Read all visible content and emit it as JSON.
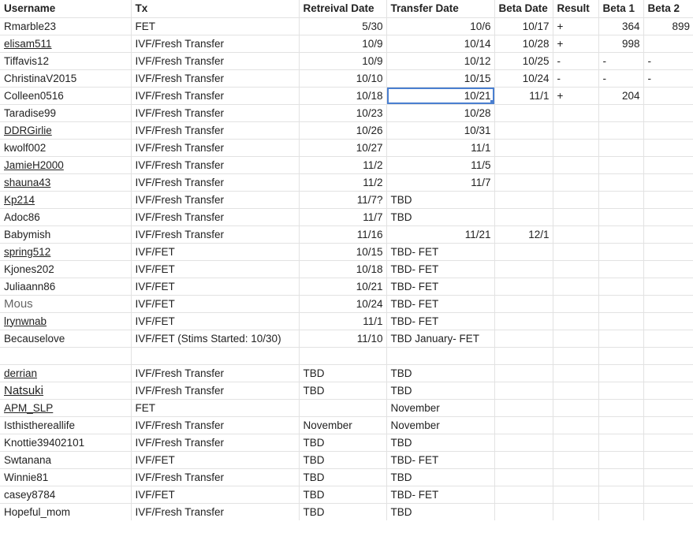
{
  "headers": {
    "username": "Username",
    "tx": "Tx",
    "retrieval": "Retreival Date",
    "transfer": "Transfer Date",
    "beta_date": "Beta Date",
    "result": "Result",
    "beta1": "Beta 1",
    "beta2": "Beta 2"
  },
  "rows": [
    {
      "user": "Rmarble23",
      "tx": "FET",
      "ret": "5/30",
      "tr": "10/6",
      "beta": "10/17",
      "res": "+",
      "b1": "364",
      "b2": "899"
    },
    {
      "user": "elisam511",
      "tx": "IVF/Fresh Transfer",
      "ret": "10/9",
      "tr": "10/14",
      "beta": "10/28",
      "res": "+",
      "b1": "998",
      "b2": ""
    },
    {
      "user": "Tiffavis12",
      "tx": "IVF/Fresh Transfer",
      "ret": "10/9",
      "tr": "10/12",
      "beta": "10/25",
      "res": "-",
      "b1": "-",
      "b2": "-"
    },
    {
      "user": "ChristinaV2015",
      "tx": "IVF/Fresh Transfer",
      "ret": "10/10",
      "tr": "10/15",
      "beta": "10/24",
      "res": "-",
      "b1": "-",
      "b2": "-"
    },
    {
      "user": "Colleen0516",
      "tx": "IVF/Fresh Transfer",
      "ret": "10/18",
      "tr": "10/21",
      "beta": "11/1",
      "res": "+",
      "b1": "204",
      "b2": ""
    },
    {
      "user": "Taradise99",
      "tx": "IVF/Fresh Transfer",
      "ret": "10/23",
      "tr": "10/28",
      "beta": "",
      "res": "",
      "b1": "",
      "b2": ""
    },
    {
      "user": "DDRGirlie",
      "tx": "IVF/Fresh Transfer",
      "ret": "10/26",
      "tr": "10/31",
      "beta": "",
      "res": "",
      "b1": "",
      "b2": ""
    },
    {
      "user": "kwolf002",
      "tx": "IVF/Fresh Transfer",
      "ret": "10/27",
      "tr": "11/1",
      "beta": "",
      "res": "",
      "b1": "",
      "b2": ""
    },
    {
      "user": "JamieH2000",
      "tx": "IVF/Fresh Transfer",
      "ret": "11/2",
      "tr": "11/5",
      "beta": "",
      "res": "",
      "b1": "",
      "b2": ""
    },
    {
      "user": "shauna43",
      "tx": "IVF/Fresh Transfer",
      "ret": "11/2",
      "tr": "11/7",
      "beta": "",
      "res": "",
      "b1": "",
      "b2": ""
    },
    {
      "user": "Kp214",
      "tx": "IVF/Fresh Transfer",
      "ret": "11/7?",
      "tr": "TBD",
      "beta": "",
      "res": "",
      "b1": "",
      "b2": ""
    },
    {
      "user": "Adoc86",
      "tx": "IVF/Fresh Transfer",
      "ret": "11/7",
      "tr": "TBD",
      "beta": "",
      "res": "",
      "b1": "",
      "b2": ""
    },
    {
      "user": "Babymish",
      "tx": "IVF/Fresh Transfer",
      "ret": "11/16",
      "tr": "11/21",
      "beta": "12/1",
      "res": "",
      "b1": "",
      "b2": ""
    },
    {
      "user": "spring512",
      "tx": "IVF/FET",
      "ret": "10/15",
      "tr": "TBD- FET",
      "beta": "",
      "res": "",
      "b1": "",
      "b2": ""
    },
    {
      "user": "Kjones202",
      "tx": "IVF/FET",
      "ret": "10/18",
      "tr": "TBD- FET",
      "beta": "",
      "res": "",
      "b1": "",
      "b2": ""
    },
    {
      "user": "Juliaann86",
      "tx": "IVF/FET",
      "ret": "10/21",
      "tr": "TBD- FET",
      "beta": "",
      "res": "",
      "b1": "",
      "b2": ""
    },
    {
      "user": "Mous",
      "tx": "IVF/FET",
      "ret": "10/24",
      "tr": "TBD- FET",
      "beta": "",
      "res": "",
      "b1": "",
      "b2": ""
    },
    {
      "user": "lrynwnab",
      "tx": "IVF/FET",
      "ret": "11/1",
      "tr": "TBD- FET",
      "beta": "",
      "res": "",
      "b1": "",
      "b2": ""
    },
    {
      "user": "Becauselove",
      "tx": "IVF/FET (Stims Started: 10/30)",
      "ret": "11/10",
      "tr": "TBD January- FET",
      "beta": "",
      "res": "",
      "b1": "",
      "b2": ""
    },
    {
      "user": "",
      "tx": "",
      "ret": "",
      "tr": "",
      "beta": "",
      "res": "",
      "b1": "",
      "b2": ""
    },
    {
      "user": "derrian",
      "tx": "IVF/Fresh Transfer",
      "ret": "TBD",
      "tr": "TBD",
      "beta": "",
      "res": "",
      "b1": "",
      "b2": ""
    },
    {
      "user": "Natsuki",
      "tx": "IVF/Fresh Transfer",
      "ret": "TBD",
      "tr": "TBD",
      "beta": "",
      "res": "",
      "b1": "",
      "b2": ""
    },
    {
      "user": "APM_SLP",
      "tx": "FET",
      "ret": "",
      "tr": "November",
      "beta": "",
      "res": "",
      "b1": "",
      "b2": ""
    },
    {
      "user": "Isthisthereallife",
      "tx": "IVF/Fresh Transfer",
      "ret": "November",
      "tr": "November",
      "beta": "",
      "res": "",
      "b1": "",
      "b2": ""
    },
    {
      "user": "Knottie39402101",
      "tx": "IVF/Fresh Transfer",
      "ret": "TBD",
      "tr": "TBD",
      "beta": "",
      "res": "",
      "b1": "",
      "b2": ""
    },
    {
      "user": "Swtanana",
      "tx": "IVF/FET",
      "ret": "TBD",
      "tr": "TBD- FET",
      "beta": "",
      "res": "",
      "b1": "",
      "b2": ""
    },
    {
      "user": "Winnie81",
      "tx": "IVF/Fresh Transfer",
      "ret": "TBD",
      "tr": "TBD",
      "beta": "",
      "res": "",
      "b1": "",
      "b2": ""
    },
    {
      "user": "casey8784",
      "tx": "IVF/FET",
      "ret": "TBD",
      "tr": "TBD- FET",
      "beta": "",
      "res": "",
      "b1": "",
      "b2": ""
    },
    {
      "user": "Hopeful_mom",
      "tx": "IVF/Fresh Transfer",
      "ret": "TBD",
      "tr": "TBD",
      "beta": "",
      "res": "",
      "b1": "",
      "b2": ""
    }
  ],
  "selection": {
    "color": "#4a7fd0"
  }
}
